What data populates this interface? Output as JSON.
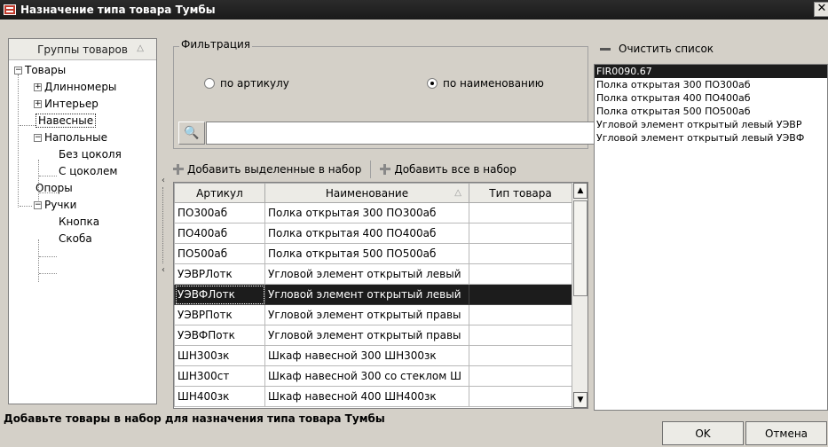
{
  "window": {
    "title": "Назначение типа товара Тумбы",
    "close_glyph": "✕"
  },
  "tree": {
    "header": "Группы товаров",
    "items": [
      {
        "label": "Товары"
      },
      {
        "label": "Длинномеры"
      },
      {
        "label": "Интерьер"
      },
      {
        "label": "Навесные"
      },
      {
        "label": "Напольные"
      },
      {
        "label": "Без цоколя"
      },
      {
        "label": "С цоколем"
      },
      {
        "label": "Опоры"
      },
      {
        "label": "Ручки"
      },
      {
        "label": "Кнопка"
      },
      {
        "label": "Скоба"
      }
    ]
  },
  "filter": {
    "legend": "Фильтрация",
    "radio_article": "по артикулу",
    "radio_name": "по наименованию",
    "selected": "по наименованию",
    "search_value": "",
    "search_placeholder": ""
  },
  "toolbar": {
    "add_selected": "Добавить выделенные в набор",
    "add_all": "Добавить все в набор"
  },
  "grid": {
    "columns": [
      "Артикул",
      "Наименование",
      "Тип товара"
    ],
    "sorted_column": "Наименование",
    "rows": [
      {
        "article": "ПО300аб",
        "name": "Полка открытая 300 ПО300аб",
        "type": ""
      },
      {
        "article": "ПО400аб",
        "name": "Полка открытая 400 ПО400аб",
        "type": ""
      },
      {
        "article": "ПО500аб",
        "name": "Полка открытая 500 ПО500аб",
        "type": ""
      },
      {
        "article": "УЭВРЛотк",
        "name": "Угловой элемент открытый левый",
        "type": ""
      },
      {
        "article": "УЭВФЛотк",
        "name": "Угловой элемент открытый левый",
        "type": ""
      },
      {
        "article": "УЭВРПотк",
        "name": "Угловой элемент открытый правы",
        "type": ""
      },
      {
        "article": "УЭВФПотк",
        "name": "Угловой элемент открытый правы",
        "type": ""
      },
      {
        "article": "ШН300зк",
        "name": "Шкаф навесной 300 ШН300зк",
        "type": ""
      },
      {
        "article": "ШН300ст",
        "name": "Шкаф навесной 300 со стеклом Ш",
        "type": ""
      },
      {
        "article": "ШН400зк",
        "name": "Шкаф навесной 400 ШН400зк",
        "type": ""
      }
    ],
    "selected_row": "УЭВФЛотк"
  },
  "right_panel": {
    "clear_label": "Очистить список",
    "items": [
      "FIR0090.67",
      "Полка открытая 300 ПО300аб",
      "Полка открытая 400 ПО400аб",
      "Полка открытая 500 ПО500аб",
      "Угловой элемент открытый левый УЭВР",
      "Угловой элемент открытый левый УЭВФ"
    ],
    "selected_item": "FIR0090.67"
  },
  "status": "Добавьте товары в набор для назначения типа товара Тумбы",
  "buttons": {
    "ok": "OK",
    "cancel": "Отмена"
  }
}
